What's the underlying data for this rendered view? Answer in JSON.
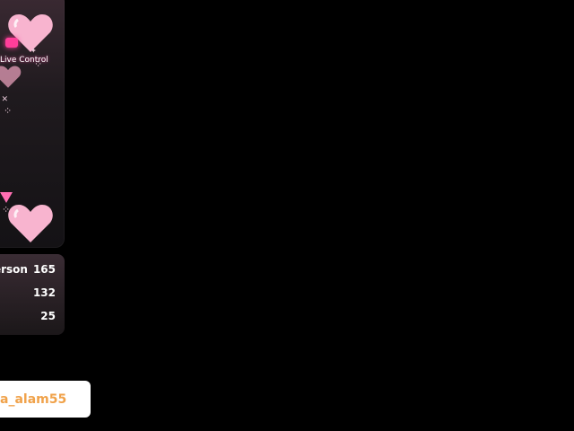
{
  "overlay": {
    "live_control_label": "Live Control",
    "accent_color": "#ff6fb3"
  },
  "leaderboard": {
    "rows": [
      {
        "name": "erson",
        "value": "165"
      },
      {
        "name": "",
        "value": "132"
      },
      {
        "name": "",
        "value": "25"
      }
    ]
  },
  "user_pill": {
    "username": "a_alam55",
    "text_color": "#f0a24a"
  }
}
